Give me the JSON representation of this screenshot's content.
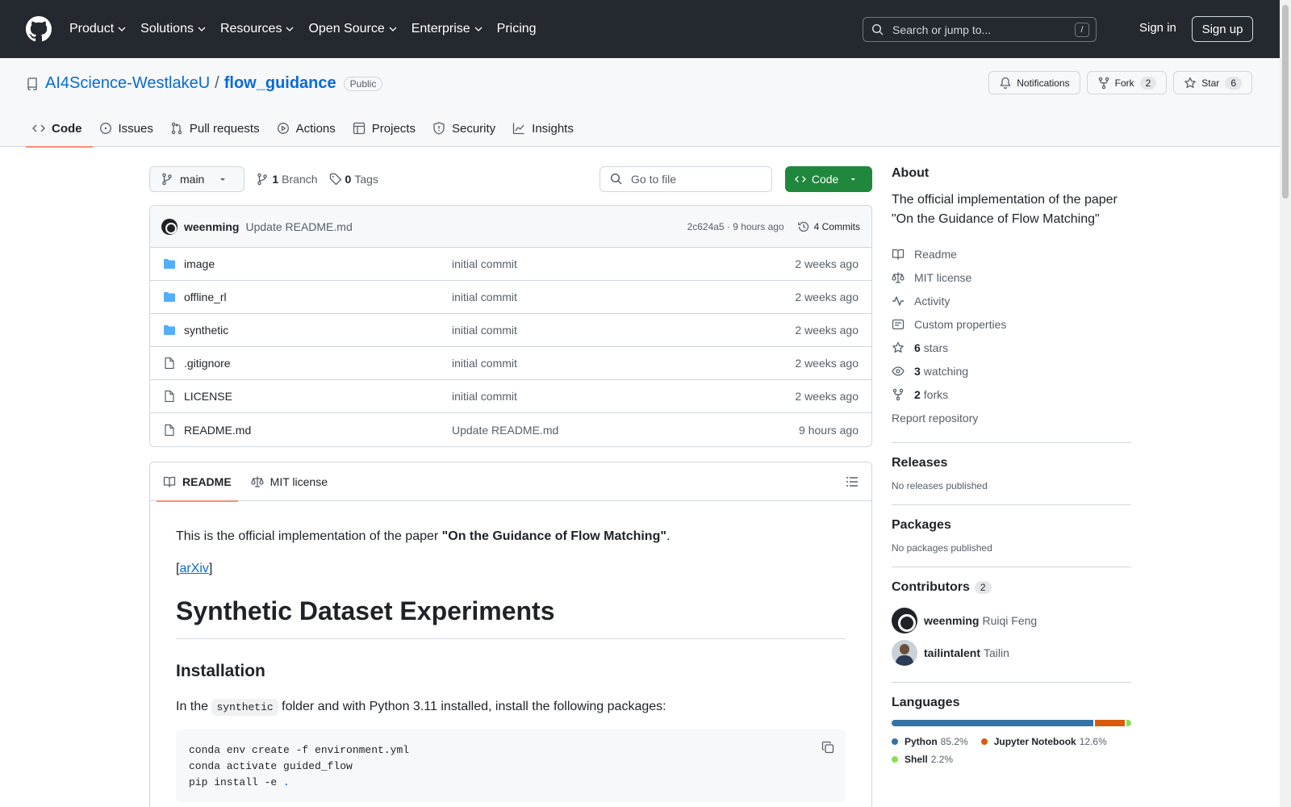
{
  "header": {
    "nav": [
      "Product",
      "Solutions",
      "Resources",
      "Open Source",
      "Enterprise",
      "Pricing"
    ],
    "search_placeholder": "Search or jump to...",
    "search_shortcut": "/",
    "sign_in": "Sign in",
    "sign_up": "Sign up"
  },
  "repo": {
    "owner": "AI4Science-WestlakeU",
    "separator": "/",
    "name": "flow_guidance",
    "visibility": "Public",
    "notifications_label": "Notifications",
    "fork_label": "Fork",
    "fork_count": "2",
    "star_label": "Star",
    "star_count": "6",
    "tabs": [
      "Code",
      "Issues",
      "Pull requests",
      "Actions",
      "Projects",
      "Security",
      "Insights"
    ]
  },
  "toolbar": {
    "branch": "main",
    "branch_count": "1",
    "branch_label": "Branch",
    "tag_count": "0",
    "tag_label": "Tags",
    "goto_placeholder": "Go to file",
    "code_label": "Code"
  },
  "commit": {
    "author": "weenming",
    "message": "Update README.md",
    "meta": "2c624a5 · 9 hours ago",
    "commits": "4 Commits"
  },
  "files": [
    {
      "type": "folder",
      "name": "image",
      "message": "initial commit",
      "date": "2 weeks ago"
    },
    {
      "type": "folder",
      "name": "offline_rl",
      "message": "initial commit",
      "date": "2 weeks ago"
    },
    {
      "type": "folder",
      "name": "synthetic",
      "message": "initial commit",
      "date": "2 weeks ago"
    },
    {
      "type": "file",
      "name": ".gitignore",
      "message": "initial commit",
      "date": "2 weeks ago"
    },
    {
      "type": "file",
      "name": "LICENSE",
      "message": "initial commit",
      "date": "2 weeks ago"
    },
    {
      "type": "file",
      "name": "README.md",
      "message": "Update README.md",
      "date": "9 hours ago"
    }
  ],
  "readme": {
    "tab_readme": "README",
    "tab_license": "MIT license",
    "intro_prefix": "This is the official implementation of the paper ",
    "intro_bold": "\"On the Guidance of Flow Matching\"",
    "intro_suffix": ".",
    "arxiv_open": "[",
    "arxiv_link": "arXiv",
    "arxiv_close": "]",
    "h1": "Synthetic Dataset Experiments",
    "h2": "Installation",
    "install_prefix": "In the ",
    "install_code": "synthetic",
    "install_suffix": " folder and with Python 3.11 installed, install the following packages:",
    "code_lines": [
      "conda env create -f environment.yml",
      "conda activate guided_flow",
      "pip install -e "
    ],
    "code_dot": "."
  },
  "sidebar": {
    "about_title": "About",
    "description": "The official implementation of the paper \"On the Guidance of Flow Matching\"",
    "links": [
      {
        "icon": "book-icon",
        "bold": "",
        "label": "Readme"
      },
      {
        "icon": "law-icon",
        "bold": "",
        "label": "MIT license"
      },
      {
        "icon": "pulse-icon",
        "bold": "",
        "label": "Activity"
      },
      {
        "icon": "note-icon",
        "bold": "",
        "label": "Custom properties"
      },
      {
        "icon": "star-icon",
        "bold": "6",
        "label": "stars"
      },
      {
        "icon": "eye-icon",
        "bold": "3",
        "label": "watching"
      },
      {
        "icon": "fork-icon",
        "bold": "2",
        "label": "forks"
      }
    ],
    "report": "Report repository",
    "releases_title": "Releases",
    "releases_text": "No releases published",
    "packages_title": "Packages",
    "packages_text": "No packages published",
    "contributors_title": "Contributors",
    "contributors_count": "2",
    "contributors": [
      {
        "login": "weenming",
        "name": "Ruiqi Feng"
      },
      {
        "login": "tailintalent",
        "name": "Tailin"
      }
    ],
    "languages_title": "Languages",
    "languages": [
      {
        "name": "Python",
        "percent": "85.2%",
        "value": 85.2,
        "color": "#3572A5"
      },
      {
        "name": "Jupyter Notebook",
        "percent": "12.6%",
        "value": 12.6,
        "color": "#DA5B0B"
      },
      {
        "name": "Shell",
        "percent": "2.2%",
        "value": 2.2,
        "color": "#89e051"
      }
    ]
  }
}
